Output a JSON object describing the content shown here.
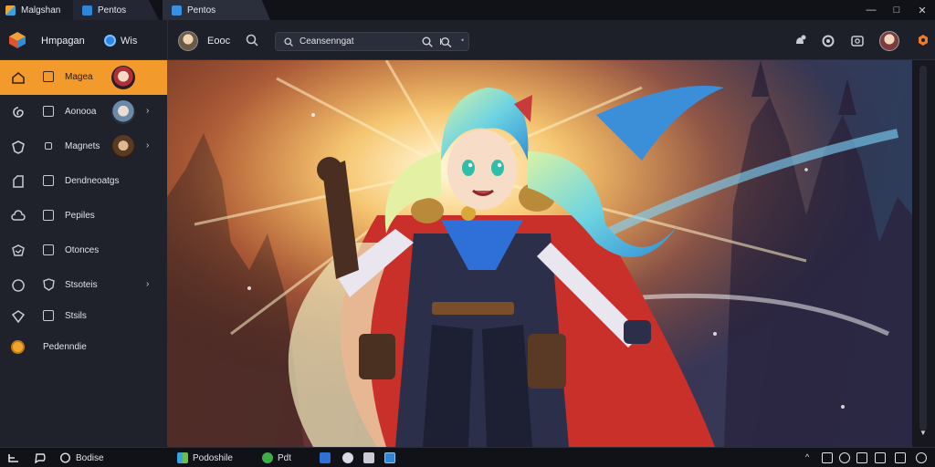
{
  "tabs": [
    {
      "label": "Malgshan",
      "icon": "app-stack-icon"
    },
    {
      "label": "Pentos",
      "icon": "blue-app-icon"
    },
    {
      "label": "Pentos",
      "icon": "blue-app-icon"
    }
  ],
  "header": {
    "brand": "Hmpagan",
    "language": "Wis",
    "user_name": "Eooc",
    "search_text": "Ceansenngat"
  },
  "sidebar": {
    "items": [
      {
        "label": "Magea",
        "icon": "home-icon",
        "thumb": true,
        "chevron": false,
        "active": true
      },
      {
        "label": "Aonooa",
        "icon": "spiral-icon",
        "thumb": true,
        "chevron": true,
        "active": false
      },
      {
        "label": "Magnets",
        "icon": "shield-icon",
        "thumb": true,
        "chevron": true,
        "active": false
      },
      {
        "label": "Dendneoatgs",
        "icon": "doc-icon",
        "thumb": false,
        "chevron": false,
        "active": false
      },
      {
        "label": "Pepiles",
        "icon": "cloud-icon",
        "thumb": false,
        "chevron": false,
        "active": false
      },
      {
        "label": "Otonces",
        "icon": "badge-icon",
        "thumb": false,
        "chevron": false,
        "active": false
      },
      {
        "label": "Stsoteis",
        "icon": "shield-outline-icon",
        "thumb": false,
        "chevron": true,
        "active": false
      },
      {
        "label": "Stsils",
        "icon": "gem-icon",
        "thumb": false,
        "chevron": false,
        "active": false
      },
      {
        "label": "Pedenndie",
        "icon": "coin-icon",
        "thumb": false,
        "chevron": false,
        "active": false
      }
    ]
  },
  "taskbar": {
    "app1": "Bodise",
    "app2": "Podoshile",
    "app3": "Pdt"
  },
  "colors": {
    "accent": "#f39a2c",
    "sidebar_bg": "#1f212b",
    "header_bg": "#1d1f29",
    "tab_bg": "#111218"
  }
}
